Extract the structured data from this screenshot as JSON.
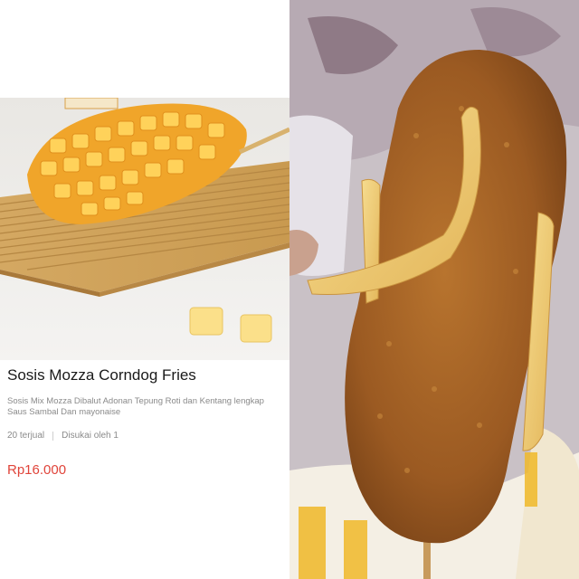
{
  "product": {
    "title": "Sosis Mozza Corndog Fries",
    "description_line1": "Sosis Mix Mozza Dibalut Adonan Tepung Roti dan Kentang lengkap",
    "description_line2": "Saus Sambal Dan mayonaise",
    "sold": "20 terjual",
    "liked": "Disukai oleh 1",
    "price": "Rp16.000"
  },
  "colors": {
    "price": "#e0443a",
    "title": "#1a1a1a",
    "muted": "#8a8a8a"
  },
  "icons": {
    "product_photo": "corndog-on-bamboo-mat",
    "reality_photo": "corndog-photo"
  }
}
